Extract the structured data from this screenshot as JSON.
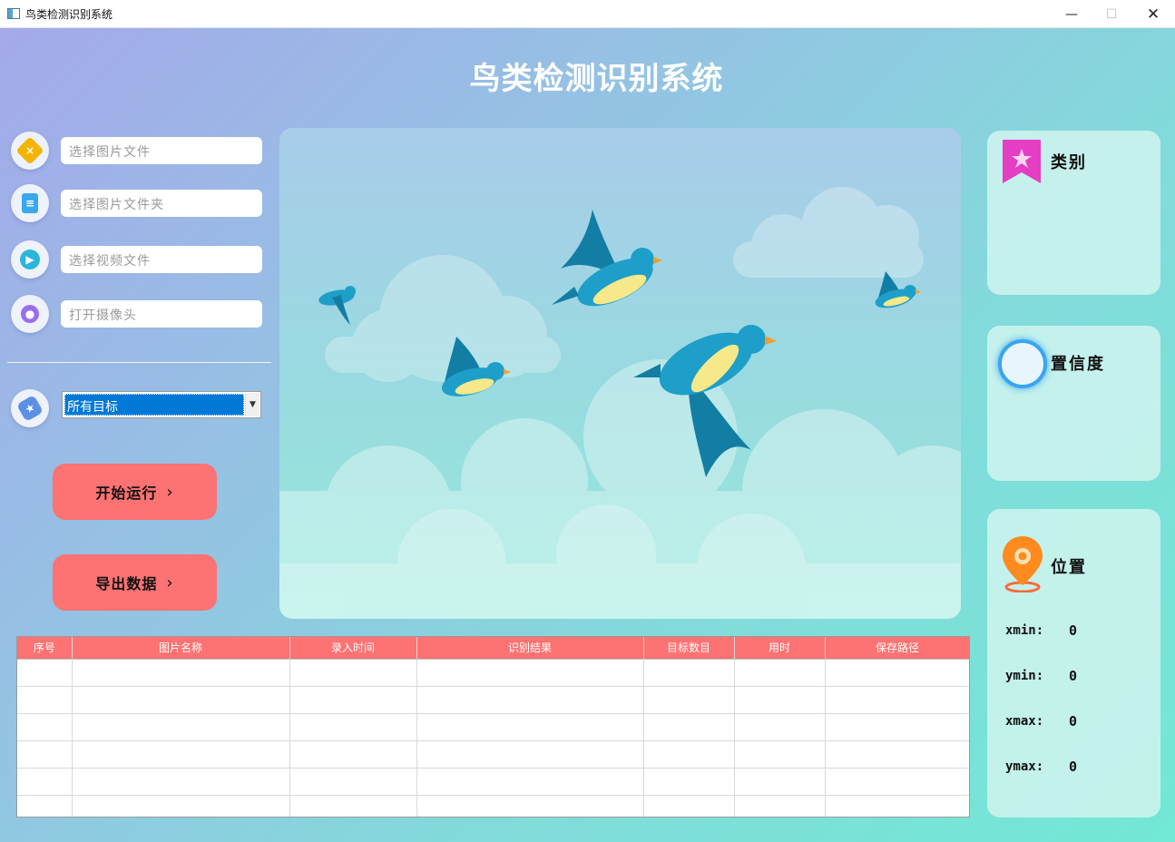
{
  "window": {
    "title": "鸟类检测识别系统",
    "controls": {
      "minimize": "—",
      "maximize": "☐",
      "close": "✕"
    }
  },
  "header": {
    "title": "鸟类检测识别系统"
  },
  "inputs": [
    {
      "placeholder": "选择图片文件",
      "icon": "image-file-icon",
      "color": "#f5b400"
    },
    {
      "placeholder": "选择图片文件夹",
      "icon": "folder-icon",
      "color": "#39a8ef"
    },
    {
      "placeholder": "选择视频文件",
      "icon": "video-icon",
      "color": "#29b6d8"
    },
    {
      "placeholder": "打开摄像头",
      "icon": "camera-icon",
      "color": "#9b6cf0"
    }
  ],
  "target_select": {
    "value": "所有目标",
    "icon": "tag-icon"
  },
  "buttons": {
    "start": "开始运行",
    "export": "导出数据",
    "chevron": "›"
  },
  "result": {
    "category_label": "类别",
    "confidence_label": "置信度",
    "position_label": "位置",
    "coords": [
      {
        "key": "xmin:",
        "value": "0"
      },
      {
        "key": "ymin:",
        "value": "0"
      },
      {
        "key": "xmax:",
        "value": "0"
      },
      {
        "key": "ymax:",
        "value": "0"
      }
    ]
  },
  "table": {
    "columns": [
      "序号",
      "图片名称",
      "录入时间",
      "识别结果",
      "目标数目",
      "用时",
      "保存路径"
    ],
    "empty_rows": 6
  },
  "colors": {
    "accent": "#fd7272",
    "select_highlight": "#0078d7",
    "bird_blue": "#1e9fc9",
    "bird_yellow": "#f7e88a"
  }
}
